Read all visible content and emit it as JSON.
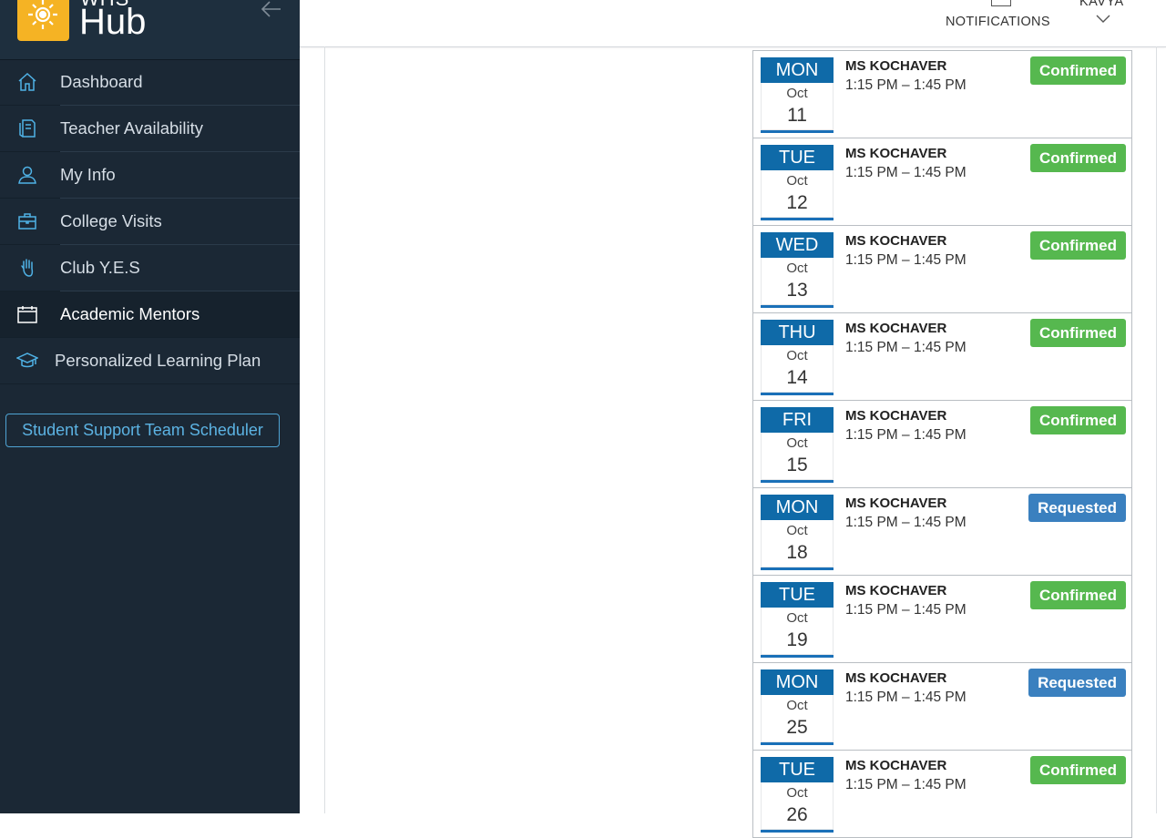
{
  "brand": {
    "top": "WHS",
    "main": "Hub"
  },
  "colors": {
    "sidebar": "#1b2835",
    "confirmed": "#56b84f",
    "requested": "#3a80bf",
    "date_header": "#0f6aa8",
    "accent": "#4fa4d4"
  },
  "sidebar": {
    "items": [
      {
        "label": "Dashboard",
        "icon": "home-icon"
      },
      {
        "label": "Teacher Availability",
        "icon": "document-icon"
      },
      {
        "label": "My Info",
        "icon": "user-icon"
      },
      {
        "label": "College Visits",
        "icon": "briefcase-icon"
      },
      {
        "label": "Club Y.E.S",
        "icon": "hand-icon"
      },
      {
        "label": "Academic Mentors",
        "icon": "calendar-icon",
        "active": true
      },
      {
        "label": "Personalized Learning Plan",
        "icon": "graduation-cap-icon"
      }
    ],
    "support_button": "Student Support Team Scheduler"
  },
  "header": {
    "notifications_label": "NOTIFICATIONS",
    "user_label": "KAVYA"
  },
  "appointments": [
    {
      "dow": "MON",
      "month": "Oct",
      "day": "11",
      "mentor": "MS KOCHAVER",
      "time": "1:15 PM – 1:45 PM",
      "status": "Confirmed"
    },
    {
      "dow": "TUE",
      "month": "Oct",
      "day": "12",
      "mentor": "MS KOCHAVER",
      "time": "1:15 PM – 1:45 PM",
      "status": "Confirmed"
    },
    {
      "dow": "WED",
      "month": "Oct",
      "day": "13",
      "mentor": "MS KOCHAVER",
      "time": "1:15 PM – 1:45 PM",
      "status": "Confirmed"
    },
    {
      "dow": "THU",
      "month": "Oct",
      "day": "14",
      "mentor": "MS KOCHAVER",
      "time": "1:15 PM – 1:45 PM",
      "status": "Confirmed"
    },
    {
      "dow": "FRI",
      "month": "Oct",
      "day": "15",
      "mentor": "MS KOCHAVER",
      "time": "1:15 PM – 1:45 PM",
      "status": "Confirmed"
    },
    {
      "dow": "MON",
      "month": "Oct",
      "day": "18",
      "mentor": "MS KOCHAVER",
      "time": "1:15 PM – 1:45 PM",
      "status": "Requested"
    },
    {
      "dow": "TUE",
      "month": "Oct",
      "day": "19",
      "mentor": "MS KOCHAVER",
      "time": "1:15 PM – 1:45 PM",
      "status": "Confirmed"
    },
    {
      "dow": "MON",
      "month": "Oct",
      "day": "25",
      "mentor": "MS KOCHAVER",
      "time": "1:15 PM – 1:45 PM",
      "status": "Requested"
    },
    {
      "dow": "TUE",
      "month": "Oct",
      "day": "26",
      "mentor": "MS KOCHAVER",
      "time": "1:15 PM – 1:45 PM",
      "status": "Confirmed"
    }
  ]
}
